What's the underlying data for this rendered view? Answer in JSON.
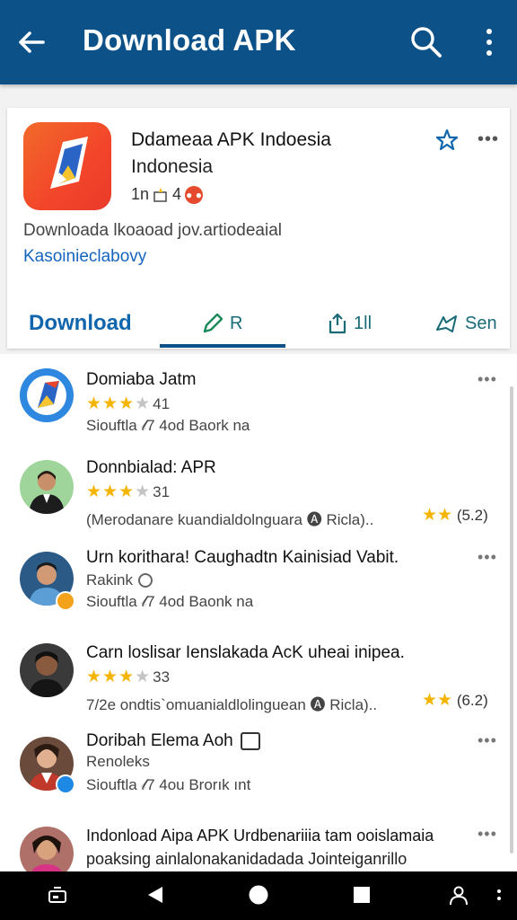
{
  "appbar": {
    "title": "Download APK",
    "back_icon": "arrow-back-icon",
    "search_icon": "search-icon",
    "more_icon": "more-vert-icon",
    "color": "#0d5189"
  },
  "app_card": {
    "name": "Ddameaa APK Indoesia",
    "subtitle": "Indonesia",
    "meta_prefix": "1n",
    "meta_count": "4",
    "description": "Dοwnloada lkoaoad jov.artiodeaial",
    "link": "Kasoinieclabovy",
    "more_label": "•••"
  },
  "tabs": [
    {
      "label": "Download"
    },
    {
      "label": "R"
    },
    {
      "label": "1ll"
    },
    {
      "label": "Sen"
    }
  ],
  "items": [
    {
      "title": "Domiaba Jatm",
      "stars": 3,
      "rating": "41",
      "line3": "Siouftla 𝓁7 4od Baork na",
      "more": "•••"
    },
    {
      "title": "Donnbialad: APR",
      "stars": 3,
      "rating": "31",
      "line3": "(Merodanare kuandialdolnguara 🅐 Ricla)..",
      "right_rating": "(5.2)",
      "more": ""
    },
    {
      "title": "Urn korithara! Caughadtn Kainisiad Vabit.",
      "sub": "Rakink",
      "line3": "Siouftla 𝓁7 4od Baonk na",
      "more": "•••"
    },
    {
      "title": "Carn loslisar Ienslakada AcK uheai inipea.",
      "stars": 3,
      "rating": "33",
      "line3": "7/2e ondtis`omuanialdlolinguean 🅐 Ricla)..",
      "right_rating": "(6.2)",
      "more": ""
    },
    {
      "title": "Doribah Elema Aoh",
      "sub": "Renoleks",
      "line3": "Siouftla 𝓁7 4ou Brorık ınt",
      "more": "•••"
    },
    {
      "title": "Indonload Aipa APK Urdbenariiia tam ooislamaia",
      "line3": "poaksing ainlalonakanidadada Jointeiganrillo",
      "more": "•••"
    }
  ],
  "navbar": {
    "icons": [
      "cast-icon",
      "back-triangle-icon",
      "home-circle-icon",
      "recents-square-icon",
      "accessibility-icon",
      "more-dot-icon"
    ]
  }
}
